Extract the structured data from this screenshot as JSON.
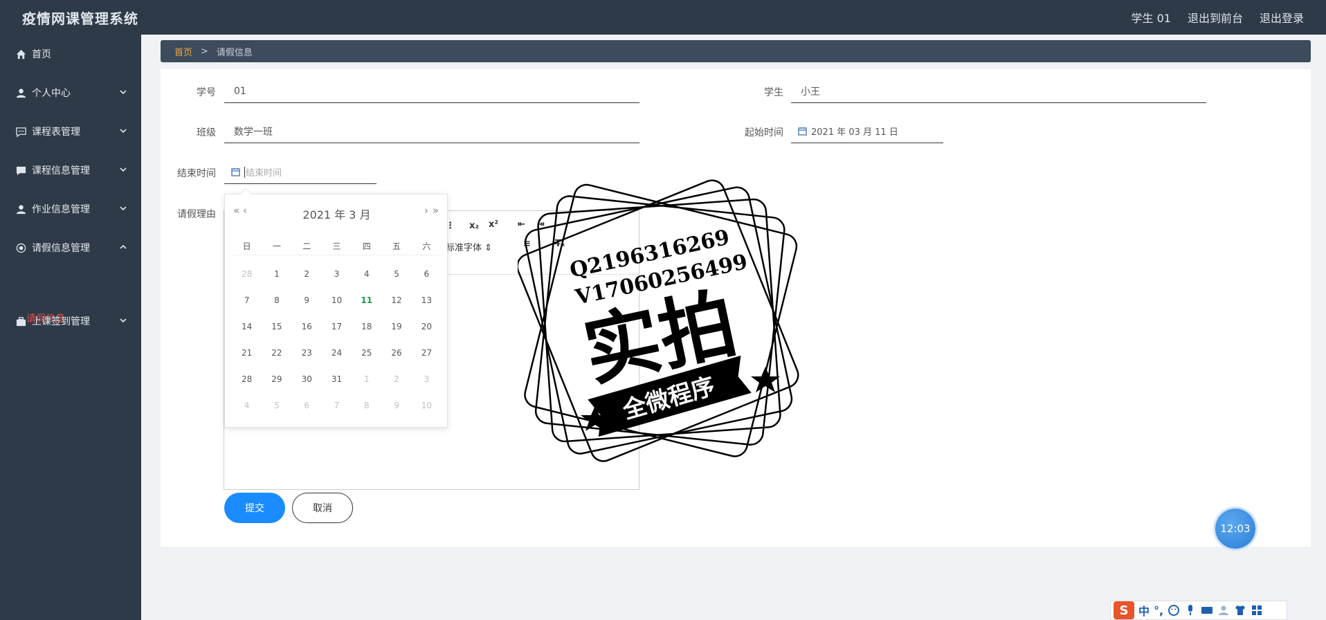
{
  "app": {
    "title": "疫情网课管理系统"
  },
  "topbar": {
    "user": "学生 01",
    "exit_front": "退出到前台",
    "logout": "退出登录"
  },
  "sidebar": {
    "items": [
      {
        "label": "首页",
        "icon": "home-icon"
      },
      {
        "label": "个人中心",
        "icon": "user-icon"
      },
      {
        "label": "课程表管理",
        "icon": "chat-icon"
      },
      {
        "label": "课程信息管理",
        "icon": "comment-icon"
      },
      {
        "label": "作业信息管理",
        "icon": "user-icon"
      },
      {
        "label": "请假信息管理",
        "icon": "circle-icon"
      },
      {
        "label": "上课签到管理",
        "icon": "briefcase-icon"
      }
    ],
    "sub_active": "请假信息"
  },
  "breadcrumb": {
    "home": "首页",
    "sep": ">",
    "current": "请假信息"
  },
  "form": {
    "student_no": {
      "label": "学号",
      "value": "01"
    },
    "student": {
      "label": "学生",
      "value": "小王"
    },
    "class": {
      "label": "班级",
      "value": "数学一班"
    },
    "start_time": {
      "label": "起始时间",
      "value": "2021 年 03 月 11 日"
    },
    "end_time": {
      "label": "结束时间",
      "placeholder": "结束时间"
    },
    "reason": {
      "label": "请假理由"
    },
    "editor_font": "标准字体",
    "submit": "提交",
    "cancel": "取消"
  },
  "datepicker": {
    "title": "2021 年  3 月",
    "prev_year": "«",
    "prev_month": "‹",
    "next_month": "›",
    "next_year": "»",
    "weekdays": [
      "日",
      "一",
      "二",
      "三",
      "四",
      "五",
      "六"
    ],
    "weeks": [
      [
        "28",
        "1",
        "2",
        "3",
        "4",
        "5",
        "6"
      ],
      [
        "7",
        "8",
        "9",
        "10",
        "11",
        "12",
        "13"
      ],
      [
        "14",
        "15",
        "16",
        "17",
        "18",
        "19",
        "20"
      ],
      [
        "21",
        "22",
        "23",
        "24",
        "25",
        "26",
        "27"
      ],
      [
        "28",
        "29",
        "30",
        "31",
        "1",
        "2",
        "3"
      ],
      [
        "4",
        "5",
        "6",
        "7",
        "8",
        "9",
        "10"
      ]
    ],
    "today": "11"
  },
  "watermark": {
    "line1": "Q2196316269",
    "line2": "V17060256499",
    "big": "实拍",
    "banner": "全微程序"
  },
  "clock": "12:03",
  "ime": {
    "mode": "中",
    "punct": "°,"
  },
  "colors": {
    "sidebar": "#2f3a48",
    "breadcrumb": "#3d4b5c",
    "active": "#e44c4c",
    "home_link": "#f0a93c",
    "primary": "#1a8cff"
  }
}
